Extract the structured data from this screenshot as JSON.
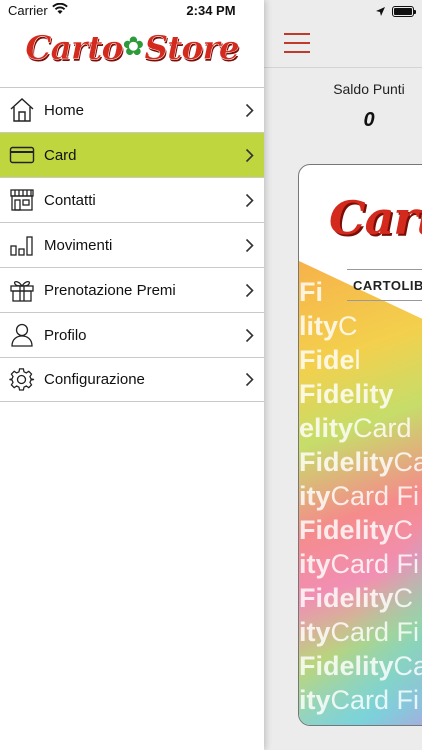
{
  "statusbar": {
    "carrier": "Carrier",
    "time": "2:34 PM"
  },
  "brand": {
    "logo_text_a": "Carto",
    "logo_text_b": "Store",
    "primary_color": "#d42a1e",
    "accent_color": "#bfd63f"
  },
  "menu": {
    "items": [
      {
        "label": "Home",
        "icon": "home-icon",
        "active": false
      },
      {
        "label": "Card",
        "icon": "card-icon",
        "active": true
      },
      {
        "label": "Contatti",
        "icon": "store-icon",
        "active": false
      },
      {
        "label": "Movimenti",
        "icon": "bar-chart-icon",
        "active": false
      },
      {
        "label": "Prenotazione Premi",
        "icon": "gift-icon",
        "active": false
      },
      {
        "label": "Profilo",
        "icon": "user-icon",
        "active": false
      },
      {
        "label": "Configurazione",
        "icon": "gear-icon",
        "active": false
      }
    ]
  },
  "main": {
    "saldo_label": "Saldo Punti",
    "saldo_value": "0",
    "card": {
      "logo": "Carto",
      "shop": "CARTOLIB",
      "fidelity_rows": [
        [
          "Fi",
          ""
        ],
        [
          "lity",
          "C"
        ],
        [
          "Fide",
          "l"
        ],
        [
          "Fidelity",
          ""
        ],
        [
          "elity",
          "Card"
        ],
        [
          "Fidelity",
          "Ca"
        ],
        [
          "ity",
          "Card Fi"
        ],
        [
          "Fidelity",
          "C"
        ],
        [
          "ity",
          "Card Fi"
        ],
        [
          "Fidelity",
          "C"
        ],
        [
          "ity",
          "Card Fi"
        ],
        [
          "Fidelity",
          "Ca"
        ],
        [
          "ity",
          "Card Fi"
        ]
      ]
    }
  }
}
